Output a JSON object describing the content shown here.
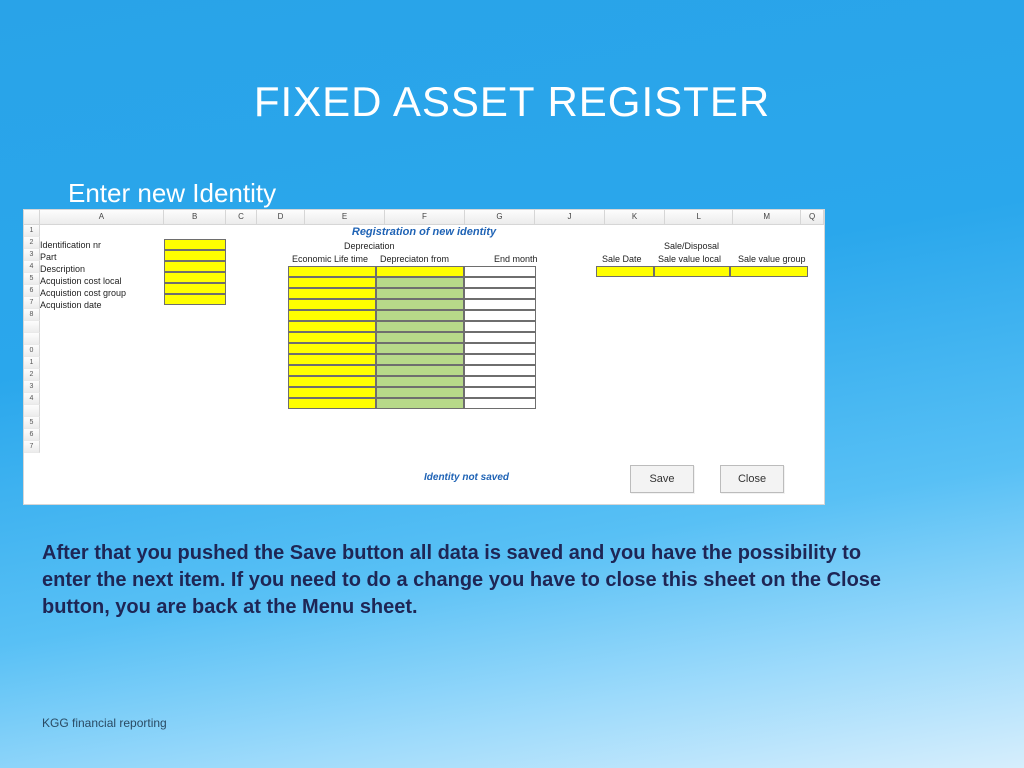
{
  "slide": {
    "title": "FIXED ASSET REGISTER",
    "subtitle": "Enter new Identity",
    "body_text": "After that you pushed the Save button all data is saved and you have the possibility to enter the next item. If you need to do a change you have to close this sheet on the Close button, you are back at the Menu sheet.",
    "footer": "KGG financial reporting"
  },
  "excel": {
    "columns": [
      "",
      "A",
      "B",
      "C",
      "D",
      "E",
      "F",
      "G",
      "J",
      "K",
      "L",
      "M",
      "Q"
    ],
    "row_numbers": [
      "1",
      "2",
      "3",
      "4",
      "5",
      "6",
      "7",
      "8",
      "",
      "",
      "0",
      "1",
      "2",
      "3",
      "4",
      "",
      "5",
      "6",
      "7"
    ],
    "sheet_title": "Registration of new identity",
    "left_labels": [
      "Identification nr",
      "Part",
      "Description",
      "Acquistion cost local",
      "Acquistion cost group",
      "Acquistion date"
    ],
    "sections": {
      "depreciation": {
        "title": "Depreciation",
        "sub": [
          "Economic Life time",
          "Depreciaton from",
          "End month"
        ]
      },
      "sale": {
        "title": "Sale/Disposal",
        "sub": [
          "Sale Date",
          "Sale value local",
          "Sale value group"
        ]
      }
    },
    "status_message": "Identity not saved",
    "buttons": {
      "save": "Save",
      "close": "Close"
    }
  }
}
